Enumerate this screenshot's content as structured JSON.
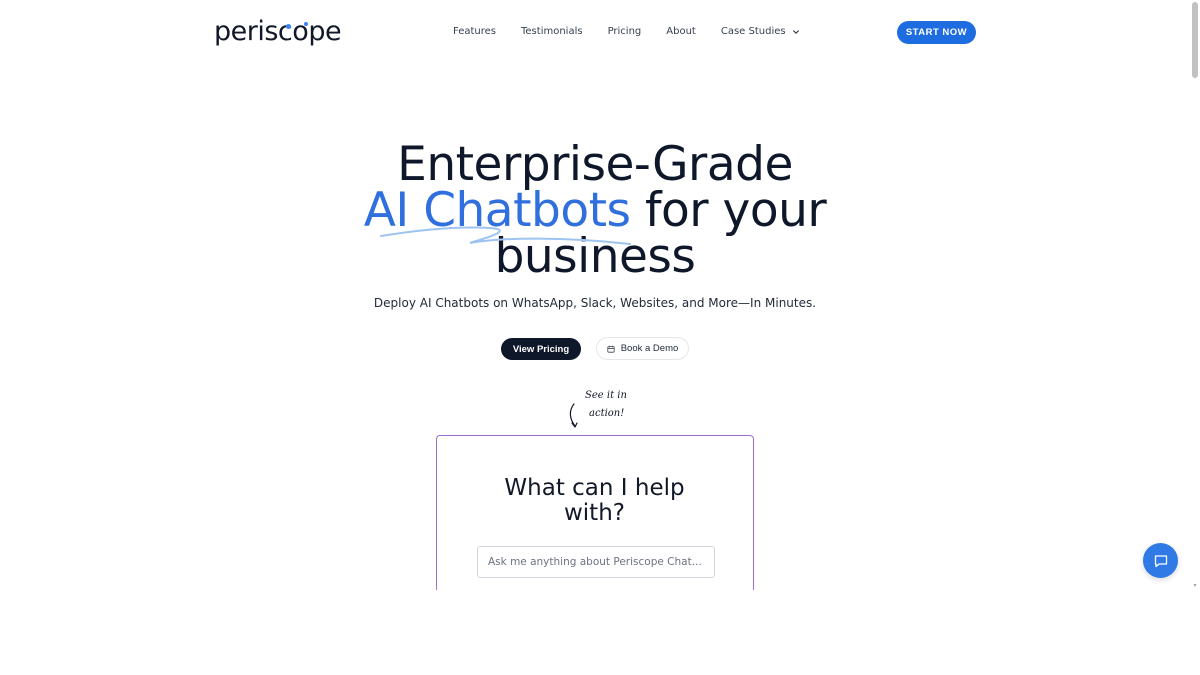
{
  "brand": {
    "logo_prefix": "peris",
    "logo_accent_letter": "c",
    "logo_suffix": "ope",
    "accent_color": "#2f6fde",
    "cta_color": "#1d6de0",
    "card_border_color": "#a070cf"
  },
  "nav": {
    "items": [
      {
        "label": "Features"
      },
      {
        "label": "Testimonials"
      },
      {
        "label": "Pricing"
      },
      {
        "label": "About"
      },
      {
        "label": "Case Studies",
        "icon": "chevron-down-icon"
      }
    ],
    "cta_label": "START NOW"
  },
  "hero": {
    "title_line1": "Enterprise-Grade",
    "title_line2_accent": "AI Chatbots",
    "title_line2_rest": " for your",
    "title_line3": "business",
    "subtitle": "Deploy AI Chatbots on WhatsApp, Slack, Websites, and More—In Minutes.",
    "primary_button": "View Pricing",
    "secondary_button": "Book a Demo",
    "secondary_button_icon": "calendar-icon",
    "handwritten_line1": "See it in",
    "handwritten_line2": "action!"
  },
  "demo": {
    "heading_line1": "What can I help",
    "heading_line2": "with?",
    "input_placeholder": "Ask me anything about Periscope Chat..."
  },
  "chat_widget": {
    "icon": "chat-bubble-icon"
  }
}
